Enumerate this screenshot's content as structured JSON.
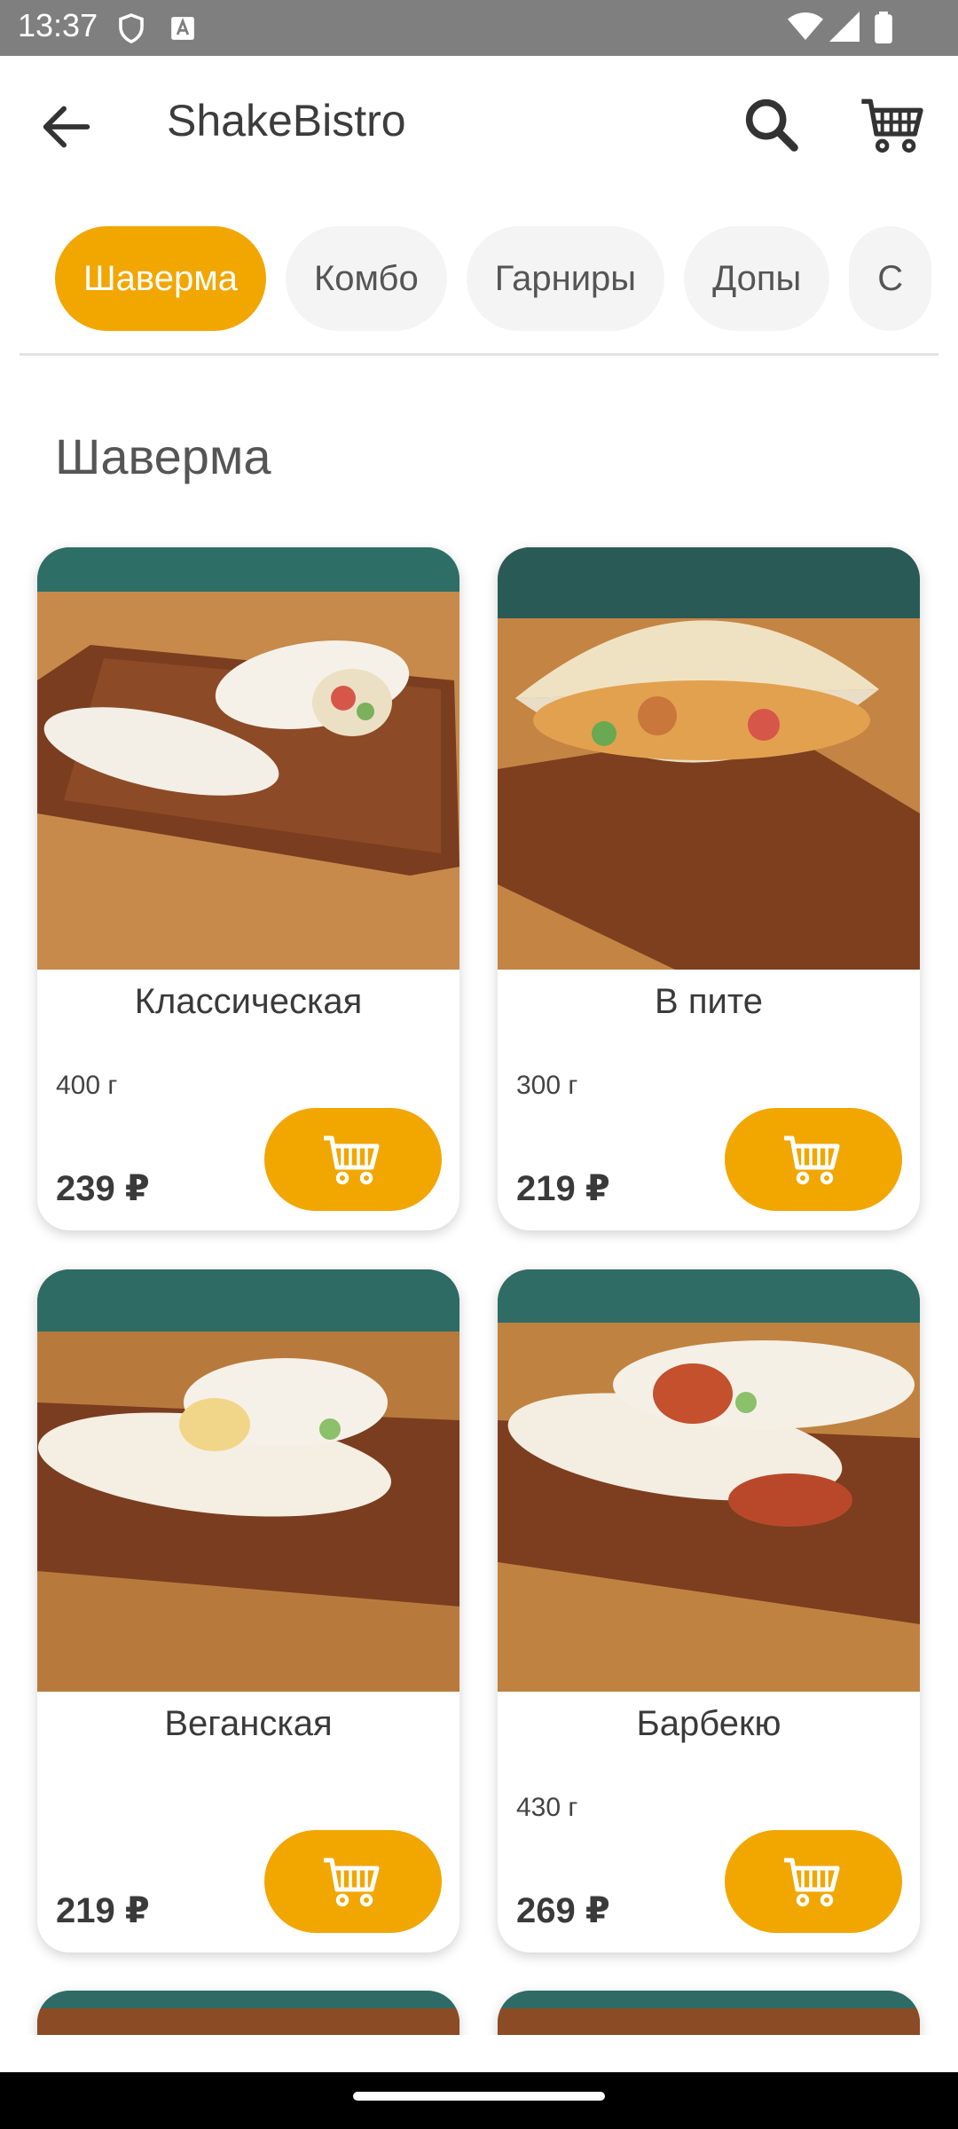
{
  "status_bar": {
    "time": "13:37"
  },
  "app_bar": {
    "title": "ShakeBistro"
  },
  "tabs": [
    {
      "label": "Шаверма",
      "active": true
    },
    {
      "label": "Комбо",
      "active": false
    },
    {
      "label": "Гарниры",
      "active": false
    },
    {
      "label": "Допы",
      "active": false
    },
    {
      "label": "С",
      "active": false
    }
  ],
  "section": {
    "title": "Шаверма"
  },
  "products": [
    {
      "name": "Классическая",
      "weight": "400 г",
      "price": "239 ₽"
    },
    {
      "name": "В пите",
      "weight": "300 г",
      "price": "219 ₽"
    },
    {
      "name": "Веганская",
      "weight": "",
      "price": "219 ₽"
    },
    {
      "name": "Барбекю",
      "weight": "430 г",
      "price": "269 ₽"
    }
  ],
  "colors": {
    "accent": "#f2a600",
    "statusbar": "#7f7f7f"
  },
  "icons": [
    "back-arrow-icon",
    "search-icon",
    "cart-icon",
    "shield-icon",
    "font-icon",
    "wifi-icon",
    "signal-icon",
    "battery-icon",
    "add-to-cart-icon"
  ]
}
